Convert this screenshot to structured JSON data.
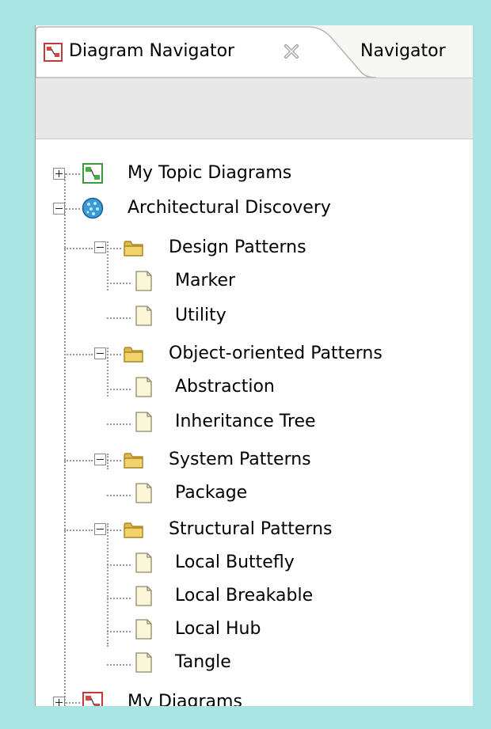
{
  "tabs": {
    "active_label": "Diagram Navigator",
    "inactive_label": "Navigator"
  },
  "tree": {
    "my_topic_diagrams": "My Topic Diagrams",
    "architectural_discovery": "Architectural Discovery",
    "design_patterns": {
      "label": "Design Patterns",
      "children": [
        "Marker",
        "Utility"
      ]
    },
    "object_oriented_patterns": {
      "label": "Object-oriented Patterns",
      "children": [
        "Abstraction",
        "Inheritance Tree"
      ]
    },
    "system_patterns": {
      "label": "System Patterns",
      "children": [
        "Package"
      ]
    },
    "structural_patterns": {
      "label": "Structural Patterns",
      "children": [
        "Local Buttefly",
        "Local Breakable",
        "Local Hub",
        "Tangle"
      ]
    },
    "my_diagrams": "My Diagrams"
  },
  "colors": {
    "background": "#a8e4e2",
    "folder": "#f2d36b",
    "globe": "#3a9ad6"
  }
}
